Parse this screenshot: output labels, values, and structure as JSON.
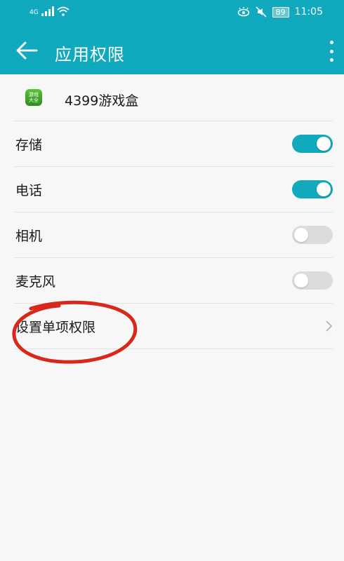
{
  "status_bar": {
    "network": "4G",
    "battery": "89",
    "time": "11:05"
  },
  "header": {
    "title": "应用权限"
  },
  "app": {
    "icon_text_line1": "游戏",
    "icon_text_line2": "大全",
    "name": "4399游戏盒"
  },
  "permissions": [
    {
      "label": "存储",
      "enabled": true
    },
    {
      "label": "电话",
      "enabled": true
    },
    {
      "label": "相机",
      "enabled": false
    },
    {
      "label": "麦克风",
      "enabled": false
    }
  ],
  "single_permission": {
    "label": "设置单项权限"
  },
  "colors": {
    "accent": "#11a9bd",
    "annotation": "#d8281c"
  }
}
